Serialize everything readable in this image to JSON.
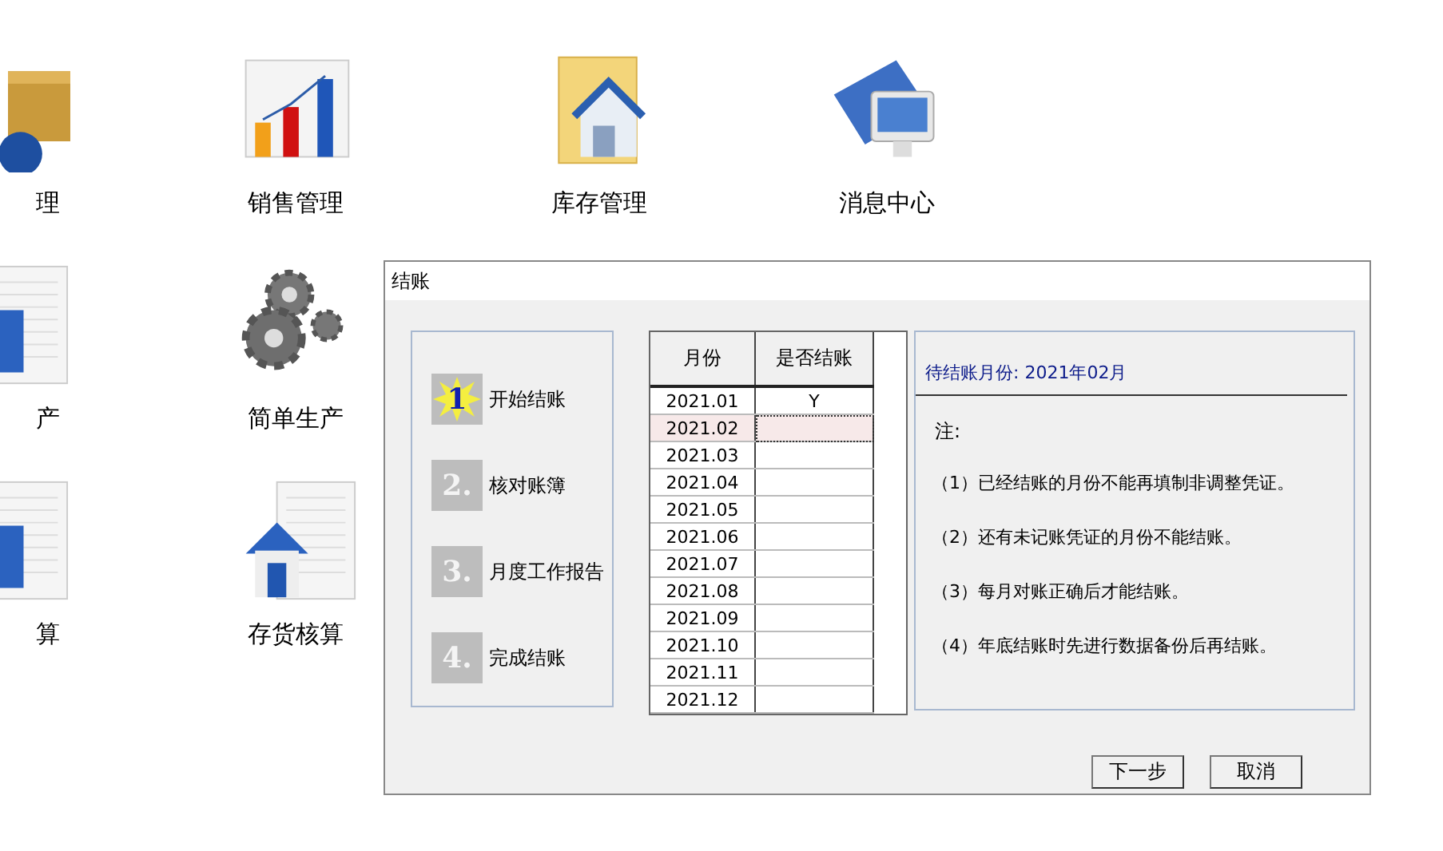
{
  "desktop_icons": [
    {
      "label": "理",
      "kind": "box"
    },
    {
      "label": "销售管理",
      "kind": "chart"
    },
    {
      "label": "库存管理",
      "kind": "folder"
    },
    {
      "label": "消息中心",
      "kind": "monitor"
    },
    {
      "label": "产",
      "kind": "doc"
    },
    {
      "label": "简单生产",
      "kind": "gears"
    },
    {
      "label": "算",
      "kind": "doc"
    },
    {
      "label": "存货核算",
      "kind": "dochouse"
    }
  ],
  "dialog": {
    "title": "结账",
    "steps": [
      {
        "number": "1",
        "label": "开始结账",
        "selected": true
      },
      {
        "number": "2.",
        "label": "核对账簿",
        "selected": false
      },
      {
        "number": "3.",
        "label": "月度工作报告",
        "selected": false
      },
      {
        "number": "4.",
        "label": "完成结账",
        "selected": false
      }
    ],
    "table": {
      "columns": [
        "月份",
        "是否结账"
      ],
      "rows": [
        {
          "month": "2021.01",
          "closed": "Y",
          "selected": false
        },
        {
          "month": "2021.02",
          "selected": true
        },
        {
          "month": "2021.03",
          "selected": false
        },
        {
          "month": "2021.04",
          "selected": false
        },
        {
          "month": "2021.05",
          "selected": false
        },
        {
          "month": "2021.06",
          "selected": false
        },
        {
          "month": "2021.07",
          "selected": false
        },
        {
          "month": "2021.08",
          "selected": false
        },
        {
          "month": "2021.09",
          "selected": false
        },
        {
          "month": "2021.10",
          "selected": false
        },
        {
          "month": "2021.11",
          "selected": false
        },
        {
          "month": "2021.12",
          "selected": false
        }
      ]
    },
    "info": {
      "heading": "待结账月份: 2021年02月",
      "note_label": "注:",
      "notes": [
        "（1）已经结账的月份不能再填制非调整凭证。",
        "（2）还有未记账凭证的月份不能结账。",
        "（3）每月对账正确后才能结账。",
        "（4）年底结账时先进行数据备份后再结账。"
      ]
    },
    "buttons": [
      "下一步",
      "取消"
    ]
  }
}
